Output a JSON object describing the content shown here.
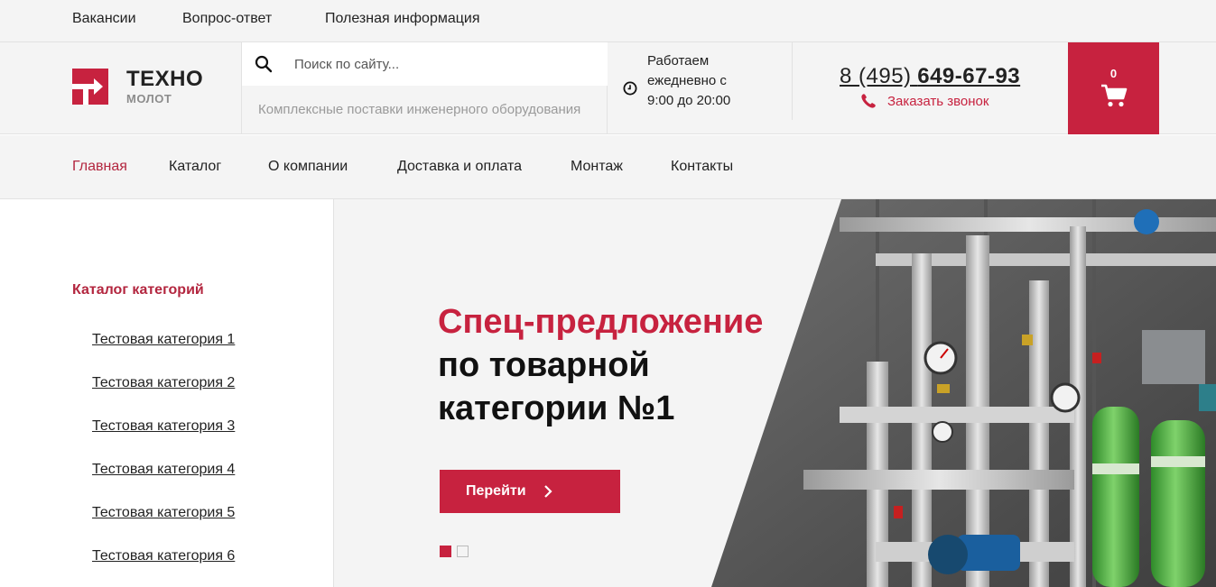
{
  "topbar": {
    "links": [
      "Вакансии",
      "Вопрос-ответ",
      "Полезная информация"
    ]
  },
  "header": {
    "logo_title": "ТЕХНО",
    "logo_subtitle": "МОЛОТ",
    "search_placeholder": "Поиск по сайту...",
    "tagline": "Комплексные поставки инженерного оборудования",
    "hours_line1": "Работаем",
    "hours_line2": "ежедневно с",
    "hours_line3": "9:00 до 20:00",
    "phone_prefix": "8 (495)",
    "phone_number": "649-67-93",
    "callback_label": "Заказать звонок",
    "cart_count": "0"
  },
  "nav": {
    "items": [
      "Главная",
      "Каталог",
      "О компании",
      "Доставка и оплата",
      "Монтаж",
      "Контакты"
    ],
    "active_index": 0
  },
  "sidebar": {
    "title": "Каталог категорий",
    "items": [
      "Тестовая категория 1",
      "Тестовая категория 2",
      "Тестовая категория 3",
      "Тестовая категория 4",
      "Тестовая категория 5",
      "Тестовая категория 6"
    ]
  },
  "hero": {
    "title_accent": "Спец-предложение",
    "title_rest": "по товарной категории №1",
    "button_label": "Перейти",
    "slide_count": 2,
    "active_slide": 1
  },
  "colors": {
    "brand": "#c7223f",
    "nav_active": "#b3263f",
    "background_light": "#f4f4f4"
  }
}
